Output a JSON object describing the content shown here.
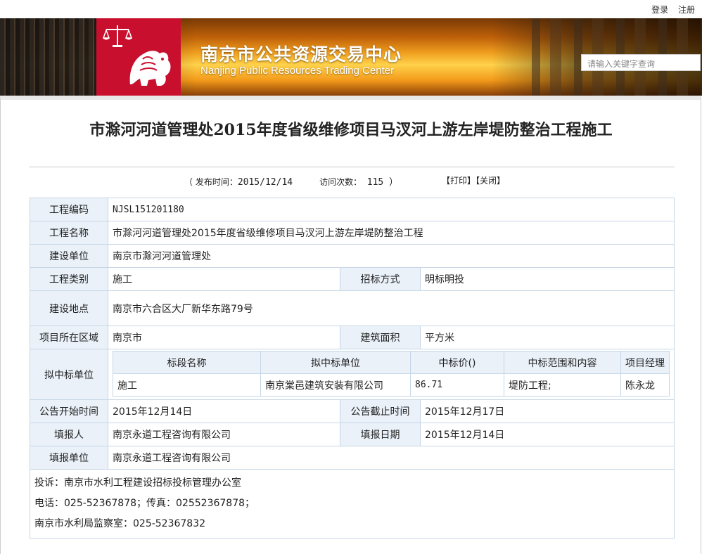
{
  "top_links": {
    "login": "登录",
    "register": "注册"
  },
  "header": {
    "title_cn": "南京市公共资源交易中心",
    "title_en": "Nanjing Public Resources Trading Center",
    "search_placeholder": "请输入关键字查询",
    "brand_color": "#c8102e"
  },
  "article": {
    "title": "市滁河河道管理处2015年度省级维修项目马汊河上游左岸堤防整治工程施工",
    "publish_label": "（ 发布时间：",
    "publish_date": "2015/12/14",
    "visits_label": "访问次数：",
    "visits": "115 ）",
    "print": "【打印】",
    "close": "【关闭】"
  },
  "table": {
    "code_label": "工程编码",
    "code": "NJSL151201180",
    "name_label": "工程名称",
    "name": "市滁河河道管理处2015年度省级维修项目马汊河上游左岸堤防整治工程",
    "builder_label": "建设单位",
    "builder": "南京市滁河河道管理处",
    "type_label": "工程类别",
    "type": "施工",
    "method_label": "招标方式",
    "method": "明标明投",
    "location_label": "建设地点",
    "location": "南京市六合区大厂新华东路79号",
    "region_label": "项目所在区域",
    "region": "南京市",
    "area_label": "建筑面积",
    "area": "平方米",
    "winner_label": "拟中标单位",
    "sub_headers": [
      "标段名称",
      "拟中标单位",
      "中标价()",
      "中标范围和内容",
      "项目经理"
    ],
    "sub_row": [
      "施工",
      "南京棠邑建筑安装有限公司",
      "86.71",
      "堤防工程;",
      "陈永龙"
    ],
    "start_label": "公告开始时间",
    "start": "2015年12月14日",
    "end_label": "公告截止时间",
    "end": "2015年12月17日",
    "filler_label": "填报人",
    "filler": "南京永道工程咨询有限公司",
    "fill_date_label": "填报日期",
    "fill_date": "2015年12月14日",
    "fill_unit_label": "填报单位",
    "fill_unit": "南京永道工程咨询有限公司",
    "complaint": "投诉：南京市水利工程建设招标投标管理办公室",
    "phone": "电话：025-52367878；传真：02552367878；",
    "supervision": "南京市水利局监察室：025-52367832"
  }
}
